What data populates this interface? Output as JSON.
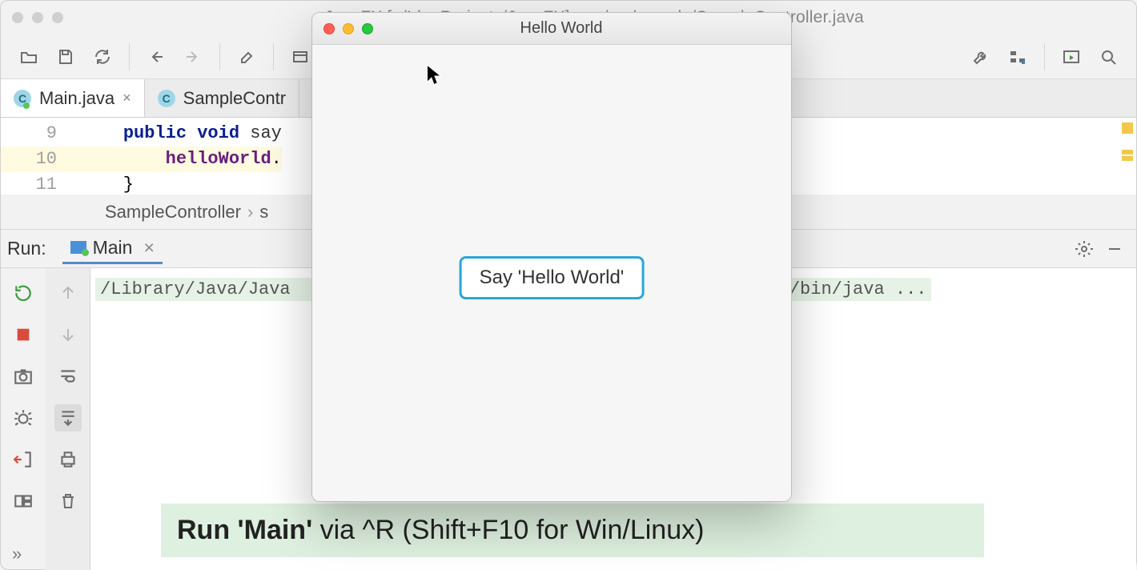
{
  "ide": {
    "title": "JavaFX [~/IdeaProjects/JavaFX] – .../src/sample/SampleController.java",
    "tabs": [
      {
        "label": "Main.java",
        "active": true
      },
      {
        "label": "SampleContr",
        "active": false
      }
    ],
    "editor": {
      "lines": [
        {
          "num": "9",
          "html_kw": "public void",
          "rest": " say"
        },
        {
          "num": "10",
          "member": "helloWorld",
          "dot": "."
        },
        {
          "num": "11",
          "plain": "    }"
        }
      ]
    },
    "breadcrumbs": {
      "a": "SampleController",
      "b": "s"
    },
    "run": {
      "panel_label": "Run:",
      "config_name": "Main",
      "console_left": "/Library/Java/Java",
      "console_right": "e/bin/java ..."
    },
    "tip_bold": "Run 'Main'",
    "tip_rest": " via ^R (Shift+F10 for Win/Linux)"
  },
  "jfx": {
    "title": "Hello World",
    "button": "Say 'Hello World'"
  }
}
